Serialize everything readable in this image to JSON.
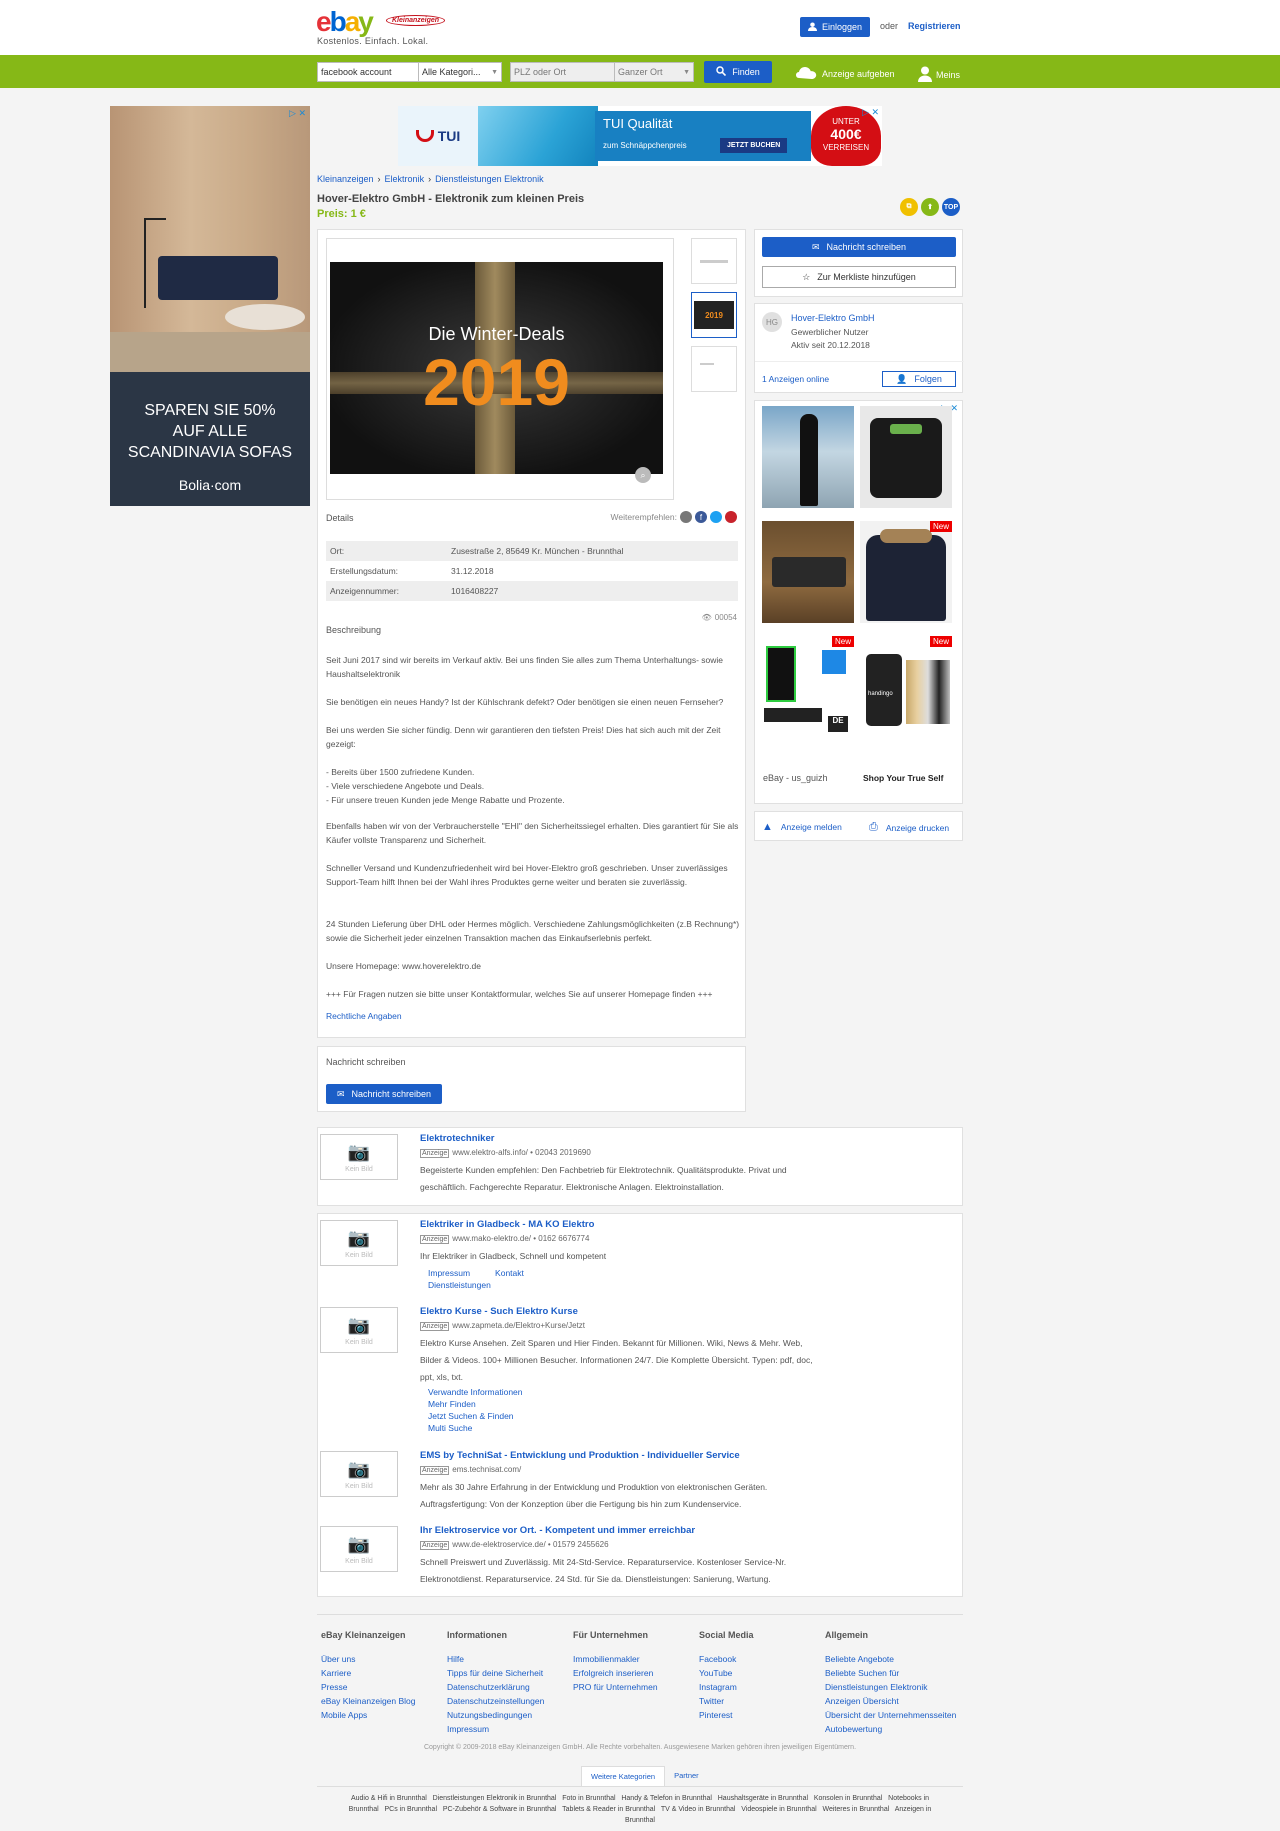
{
  "header": {
    "logo_text": "ebay",
    "logo_badge": "Kleinanzeigen",
    "slogan": "Kostenlos. Einfach. Lokal.",
    "login_label": "Einloggen",
    "or_text": "oder",
    "register_label": "Registrieren"
  },
  "search": {
    "query_value": "facebook account",
    "category_value": "Alle Kategori...",
    "location_placeholder": "PLZ oder Ort",
    "radius_value": "Ganzer Ort",
    "find_label": "Finden",
    "post_ad_label": "Anzeige aufgeben",
    "my_label": "Meins"
  },
  "left_ad": {
    "headline_line1": "SPAREN SIE 50%",
    "headline_line2": "AUF ALLE",
    "headline_line3": "SCANDINAVIA SOFAS",
    "brand": "Bolia·com"
  },
  "top_ad": {
    "brand": "TUI",
    "title": "TUI Qualität",
    "subtitle": "zum Schnäppchenpreis",
    "cta": "JETZT BUCHEN",
    "badge_top": "UNTER",
    "badge_price": "400€",
    "badge_bottom": "VERREISEN"
  },
  "breadcrumb": [
    "Kleinanzeigen",
    "Elektronik",
    "Dienstleistungen Elektronik"
  ],
  "listing": {
    "title": "Hover-Elektro GmbH - Elektronik zum kleinen Preis",
    "price": "Preis: 1 €",
    "badges": [
      "TOP"
    ],
    "image_heading": "Die Winter-Deals",
    "image_year": "2019",
    "details_label": "Details",
    "share_label": "Weiterempfehlen:",
    "details": [
      {
        "key": "Ort:",
        "value": "Zusestraße 2, 85649 Kr. München - Brunnthal"
      },
      {
        "key": "Erstellungsdatum:",
        "value": "31.12.2018"
      },
      {
        "key": "Anzeigennummer:",
        "value": "1016408227"
      }
    ],
    "views": "00054",
    "description_label": "Beschreibung",
    "description": [
      "Seit Juni 2017 sind wir bereits im Verkauf aktiv. Bei uns finden Sie alles zum Thema Unterhaltungs- sowie Haushaltselektronik",
      "Sie benötigen ein neues Handy? Ist der Kühlschrank defekt? Oder benötigen sie einen neuen Fernseher?",
      "Bei uns werden Sie sicher fündig. Denn wir garantieren den tiefsten Preis! Dies hat sich auch mit der Zeit gezeigt:",
      "- Bereits über 1500 zufriedene Kunden.\n- Viele verschiedene Angebote und Deals.\n- Für unsere treuen Kunden jede Menge Rabatte und Prozente.",
      "Ebenfalls haben wir von der Verbraucherstelle \"EHI\" den Sicherheitssiegel erhalten. Dies garantiert für Sie als Käufer vollste Transparenz und Sicherheit.",
      "Schneller Versand und Kundenzufriedenheit wird bei Hover-Elektro groß geschrieben. Unser zuverlässiges Support-Team hilft Ihnen bei der Wahl ihres Produktes gerne weiter und beraten sie zuverlässig.",
      "24 Stunden Lieferung über DHL oder Hermes möglich. Verschiedene Zahlungsmöglichkeiten (z.B Rechnung*) sowie die Sicherheit jeder einzelnen Transaktion machen das Einkaufserlebnis perfekt.",
      "Unsere Homepage: www.hoverelektro.de",
      "+++ Für Fragen nutzen sie bitte unser Kontaktformular, welches Sie auf unserer Homepage finden +++"
    ],
    "legal_link": "Rechtliche Angaben",
    "message_section_label": "Nachricht schreiben",
    "message_button": "Nachricht schreiben"
  },
  "sidebar": {
    "message_button": "Nachricht schreiben",
    "watchlist_button": "Zur Merkliste hinzufügen",
    "seller_initials": "HG",
    "seller_name": "Hover-Elektro GmbH",
    "seller_type": "Gewerblicher Nutzer",
    "seller_since": "Aktiv seit 20.12.2018",
    "ads_online": "1 Anzeigen online",
    "follow_label": "Folgen",
    "ad_footer_left": "eBay - us_guizh",
    "ad_footer_right": "Shop Your True Self",
    "new_tag": "New",
    "phone_brand": "handingo",
    "report_label": "Anzeige melden",
    "print_label": "Anzeige drucken"
  },
  "sponsored": {
    "no_image": "Kein Bild",
    "ad_tag": "Anzeige",
    "results": [
      {
        "title": "Elektrotechniker",
        "url": "www.elektro-alfs.info/",
        "phone": "02043 2019690",
        "desc": "Begeisterte Kunden empfehlen: Den Fachbetrieb für Elektrotechnik. Qualitätsprodukte. Privat und geschäftlich. Fachgerechte Reparatur. Elektronische Anlagen. Elektroinstallation.",
        "links": []
      },
      {
        "title": "Elektriker in Gladbeck - MA KO Elektro",
        "url": "www.mako-elektro.de/",
        "phone": "0162 6676774",
        "desc": "Ihr Elektriker in Gladbeck, Schnell und kompetent",
        "links": [
          "Impressum",
          "Kontakt",
          "Dienstleistungen"
        ]
      },
      {
        "title": "Elektro Kurse - Such Elektro Kurse",
        "url": "www.zapmeta.de/Elektro+Kurse/Jetzt",
        "phone": "",
        "desc": "Elektro Kurse Ansehen. Zeit Sparen und Hier Finden. Bekannt für Millionen. Wiki, News & Mehr. Web, Bilder & Videos. 100+ Millionen Besucher. Informationen 24/7. Die Komplette Übersicht. Typen: pdf, doc, ppt, xls, txt.",
        "links": [
          "Verwandte Informationen",
          "Mehr Finden",
          "Jetzt Suchen & Finden",
          "Multi Suche"
        ]
      },
      {
        "title": "EMS by TechniSat - Entwicklung und Produktion - Individueller Service",
        "url": "ems.technisat.com/",
        "phone": "",
        "desc": "Mehr als 30 Jahre Erfahrung in der Entwicklung und Produktion von elektronischen Geräten. Auftragsfertigung: Von der Konzeption über die Fertigung bis hin zum Kundenservice.",
        "links": []
      },
      {
        "title": "Ihr Elektroservice vor Ort. - Kompetent und immer erreichbar",
        "url": "www.de-elektroservice.de/",
        "phone": "01579 2455626",
        "desc": "Schnell Preiswert und Zuverlässig. Mit 24-Std-Service. Reparaturservice. Kostenloser Service-Nr. Elektronotdienst. Reparaturservice. 24 Std. für Sie da. Dienstleistungen: Sanierung, Wartung.",
        "links": []
      }
    ]
  },
  "footer": {
    "columns": [
      {
        "heading": "eBay Kleinanzeigen",
        "links": [
          "Über uns",
          "Karriere",
          "Presse",
          "eBay Kleinanzeigen Blog",
          "Mobile Apps"
        ]
      },
      {
        "heading": "Informationen",
        "links": [
          "Hilfe",
          "Tipps für deine Sicherheit",
          "Datenschutzerklärung",
          "Datenschutzeinstellungen",
          "Nutzungsbedingungen",
          "Impressum"
        ]
      },
      {
        "heading": "Für Unternehmen",
        "links": [
          "Immobilienmakler",
          "Erfolgreich inserieren",
          "PRO für Unternehmen"
        ]
      },
      {
        "heading": "Social Media",
        "links": [
          "Facebook",
          "YouTube",
          "Instagram",
          "Twitter",
          "Pinterest"
        ]
      },
      {
        "heading": "Allgemein",
        "links": [
          "Beliebte Angebote",
          "Beliebte Suchen für",
          "Dienstleistungen Elektronik",
          "Anzeigen Übersicht",
          "Übersicht der Unternehmensseiten",
          "Autobewertung"
        ]
      }
    ],
    "copyright": "Copyright © 2009-2018 eBay Kleinanzeigen GmbH. Alle Rechte vorbehalten. Ausgewiesene Marken gehören ihren jeweiligen Eigentümern.",
    "tabs": [
      "Weitere Kategorien",
      "Partner"
    ],
    "categories_line1": "Audio & Hifi in Brunnthal   Dienstleistungen Elektronik in Brunnthal   Foto in Brunnthal   Handy & Telefon in Brunnthal   Haushaltsgeräte in Brunnthal   Konsolen in Brunnthal   Notebooks in",
    "categories_line2": "Brunnthal   PCs in Brunnthal   PC-Zubehör & Software in Brunnthal   Tablets & Reader in Brunnthal   TV & Video in Brunnthal   Videospiele in Brunnthal   Weiteres in Brunnthal   Anzeigen in",
    "categories_line3": "Brunnthal"
  },
  "colors": {
    "brand_green": "#86b817",
    "brand_blue": "#1c5ec7",
    "ebay_red": "#e53238",
    "ebay_blue": "#0064d2",
    "ebay_yellow": "#f5af02",
    "ebay_green": "#86b817"
  }
}
